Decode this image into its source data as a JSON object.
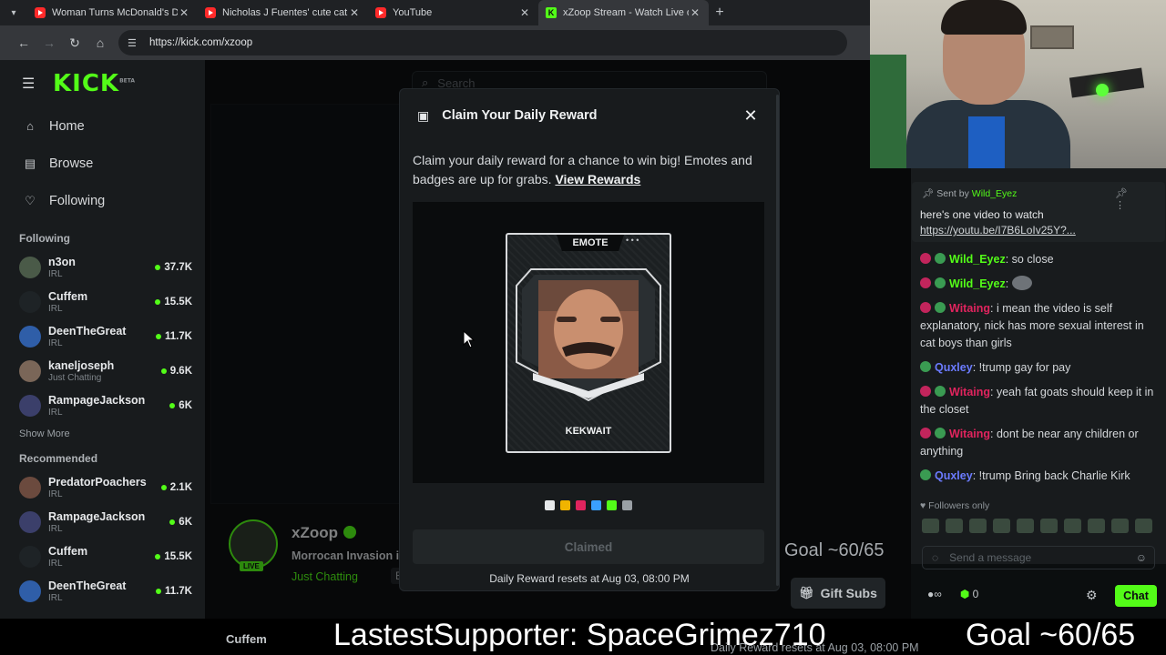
{
  "browser": {
    "tabs": [
      {
        "title": "Woman Turns McDonald's Drive",
        "icon": "youtube-icon"
      },
      {
        "title": "Nicholas J Fuentes' cute catboy",
        "icon": "youtube-icon"
      },
      {
        "title": "YouTube",
        "icon": "youtube-icon"
      },
      {
        "title": "xZoop Stream - Watch Live on K",
        "icon": "kick-icon"
      }
    ],
    "url": "https://kick.com/xzoop"
  },
  "kick": {
    "logo": "KICK",
    "logo_beta": "BETA",
    "nav": [
      {
        "label": "Home",
        "icon": "home-icon"
      },
      {
        "label": "Browse",
        "icon": "browse-icon"
      },
      {
        "label": "Following",
        "icon": "heart-icon"
      }
    ],
    "following_title": "Following",
    "following": [
      {
        "name": "n3on",
        "category": "IRL",
        "viewers": "37.7K"
      },
      {
        "name": "Cuffem",
        "category": "IRL",
        "viewers": "15.5K"
      },
      {
        "name": "DeenTheGreat",
        "category": "IRL",
        "viewers": "11.7K"
      },
      {
        "name": "kaneljoseph",
        "category": "Just Chatting",
        "viewers": "9.6K"
      },
      {
        "name": "RampageJackson",
        "category": "IRL",
        "viewers": "6K"
      }
    ],
    "show_more": "Show More",
    "recommended_title": "Recommended",
    "recommended": [
      {
        "name": "PredatorPoachers",
        "category": "IRL",
        "viewers": "2.1K"
      },
      {
        "name": "RampageJackson",
        "category": "IRL",
        "viewers": "6K"
      },
      {
        "name": "Cuffem",
        "category": "IRL",
        "viewers": "15.5K"
      },
      {
        "name": "DeenTheGreat",
        "category": "IRL",
        "viewers": "11.7K"
      }
    ],
    "search_placeholder": "Search",
    "streamer": {
      "name": "xZoop",
      "title": "Morrocan Invasion in",
      "category": "Just Chatting",
      "language": "English",
      "live": "LIVE"
    },
    "goal_text": "Goal ~60/65",
    "gift_subs": "Gift Subs"
  },
  "chat": {
    "pinned": {
      "sent_by": "Sent by",
      "user": "Wild_Eyez",
      "text": "here's one video to watch",
      "link": "https://youtu.be/I7B6LoIv25Y?..."
    },
    "messages": [
      {
        "user": "Wild_Eyez",
        "color": "#53fc18",
        "text": "so close"
      },
      {
        "user": "Wild_Eyez",
        "color": "#53fc18",
        "text": ""
      },
      {
        "user": "Witaing",
        "color": "#e0245e",
        "text": "i mean the video is self explanatory, nick has more sexual interest in cat boys than girls"
      },
      {
        "user": "Quxley",
        "color": "#6b7bff",
        "text": "!trump gay for pay"
      },
      {
        "user": "Witaing",
        "color": "#e0245e",
        "text": "yeah fat goats should keep it in the closet"
      },
      {
        "user": "Witaing",
        "color": "#e0245e",
        "text": "dont be near any children or anything"
      },
      {
        "user": "Quxley",
        "color": "#6b7bff",
        "text": "!trump Bring back Charlie Kirk"
      }
    ],
    "followers_only": "Followers only",
    "input_placeholder": "Send a message",
    "points": "0",
    "chat_button": "Chat"
  },
  "modal": {
    "title": "Claim Your Daily Reward",
    "description": "Claim your daily reward for a chance to win big! Emotes and badges are up for grabs.",
    "view_rewards": "View Rewards",
    "card_type": "EMOTE",
    "card_name": "KEKWAIT",
    "swatch_colors": [
      "#ffffff",
      "#f0b400",
      "#e0245e",
      "#3aa0ff",
      "#53fc18",
      "#9aa0a5"
    ],
    "claimed_label": "Claimed",
    "reset_text": "Daily Reward resets at Aug 03, 08:00 PM"
  },
  "overlay": {
    "supporter": "LastestSupporter: SpaceGrimez710",
    "goal": "Goal ~60/65",
    "ghost_name": "Cuffem",
    "ghost_reset": "Daily Reward resets at Aug 03, 08:00 PM"
  },
  "colors": {
    "accent": "#53fc18",
    "background": "#0b0e0f",
    "panel": "#181b1d"
  }
}
